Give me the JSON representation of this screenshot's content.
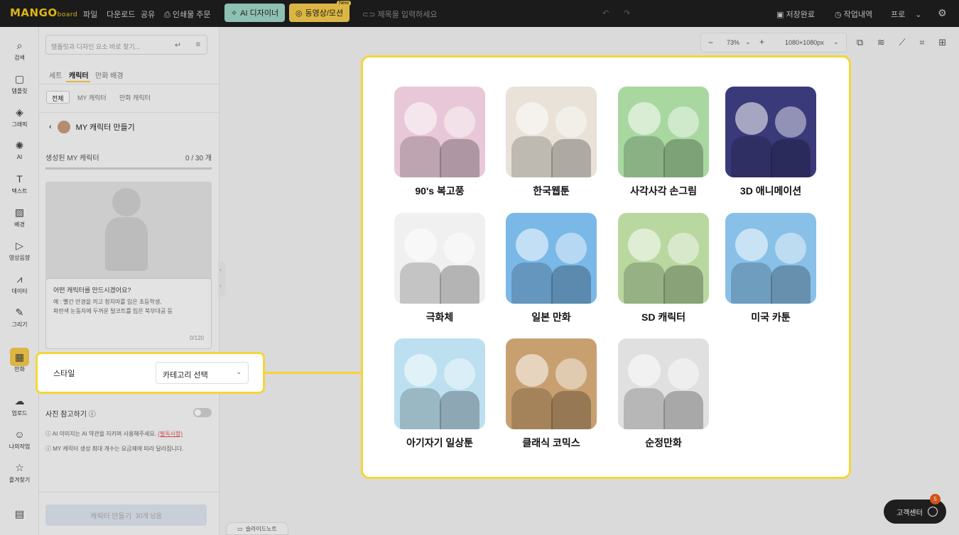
{
  "topbar": {
    "logo_main": "MANGO",
    "logo_sub": "board",
    "menu": [
      "파일",
      "다운로드",
      "공유",
      "인쇄물 주문"
    ],
    "ai_designer": "AI 디자이너",
    "video_motion": "동영상/모션",
    "new_badge": "New",
    "title_placeholder": "제목을 입력하세요",
    "save_status": "저장완료",
    "history": "작업내역",
    "plan": "프로"
  },
  "rail": {
    "items": [
      "검색",
      "템플릿",
      "그래픽",
      "AI",
      "텍스트",
      "배경",
      "영상음향",
      "데이터",
      "그리기",
      "만화",
      "업로드",
      "나의작업",
      "즐겨찾기"
    ],
    "icons": [
      "search-icon",
      "template-icon",
      "graphic-icon",
      "ai-icon",
      "text-icon",
      "background-icon",
      "video-icon",
      "data-icon",
      "draw-icon",
      "comic-icon",
      "upload-icon",
      "mywork-icon",
      "favorite-icon"
    ]
  },
  "panel": {
    "search_placeholder": "템플릿과 디자인 요소 바로 찾기...",
    "tabs": [
      "세트",
      "캐릭터",
      "만화 배경"
    ],
    "subtabs": [
      "전체",
      "MY 캐릭터",
      "만화 캐릭터"
    ],
    "mychar_title": "MY 캐릭터 만들기",
    "generated_label": "생성된 MY 캐릭터",
    "generated_count": "0 / 30 개",
    "prompt_question": "어떤 캐릭터를 만드시겠어요?",
    "prompt_example_1": "예 : 빨간 안경을 끼고 청치마를 입은 초등학생,",
    "prompt_example_2": "파란색 눈동자에 두꺼운 털코트를 입은 북부대공 등",
    "prompt_counter": "0/120",
    "photo_ref_label": "사진 참고하기",
    "note_1": "AI 이미지는 AI 약관을 지키며 사용해주세요.",
    "note_1_req": "(필독사항)",
    "note_2": "MY 캐릭터 생성 최대 개수는 요금제에 따라 달라집니다.",
    "make_button": "캐릭터 만들기",
    "make_button_sub": "30개 남음"
  },
  "canvas": {
    "zoom": "73%",
    "size": "1080×1080px",
    "slides_label": "슬라이드노트",
    "help_label": "고객센터",
    "help_badge": "5"
  },
  "style_selector": {
    "label": "스타일",
    "value": "카테고리 선택"
  },
  "styles": [
    {
      "label": "90's 복고풍",
      "bg": "#e8c8d8"
    },
    {
      "label": "한국웹툰",
      "bg": "#e8e2d8"
    },
    {
      "label": "사각사각 손그림",
      "bg": "#a8d8a0"
    },
    {
      "label": "3D 애니메이션",
      "bg": "#3a3a7a"
    },
    {
      "label": "극화체",
      "bg": "#f0f0f0"
    },
    {
      "label": "일본 만화",
      "bg": "#7ab8e8"
    },
    {
      "label": "SD 캐릭터",
      "bg": "#b8d8a0"
    },
    {
      "label": "미국 카툰",
      "bg": "#88c0e8"
    },
    {
      "label": "아기자기 일상툰",
      "bg": "#bce0f0"
    },
    {
      "label": "클래식 코믹스",
      "bg": "#c8a070"
    },
    {
      "label": "순정만화",
      "bg": "#e0e0e0"
    }
  ]
}
